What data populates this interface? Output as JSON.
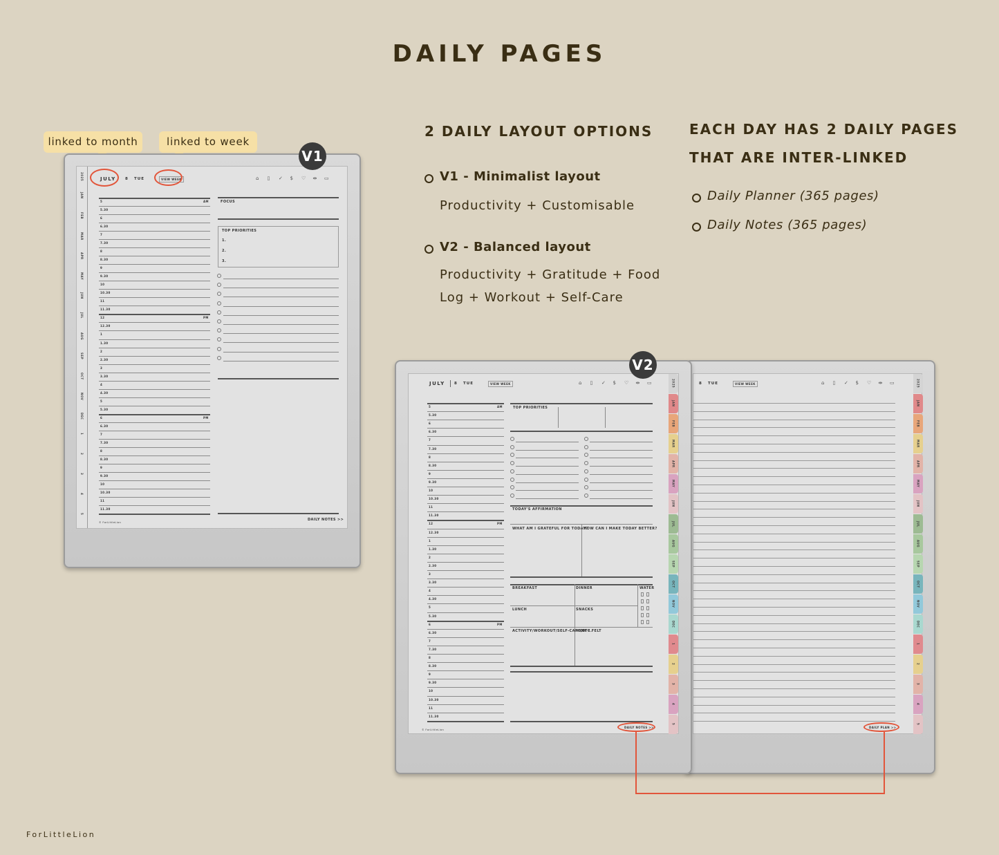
{
  "title": "DAILY PAGES",
  "callouts": {
    "month": "linked to month",
    "week": "linked to week"
  },
  "badges": {
    "v1": "V1",
    "v2": "V2"
  },
  "options": {
    "heading": "2 DAILY LAYOUT OPTIONS",
    "v1_title": "V1 - Minimalist layout",
    "v1_desc": "Productivity + Customisable",
    "v2_title": "V2 - Balanced layout",
    "v2_desc_1": "Productivity + Gratitude + Food",
    "v2_desc_2": "Log + Workout + Self-Care"
  },
  "pages": {
    "heading_1": "EACH DAY HAS 2 DAILY PAGES",
    "heading_2": "THAT ARE INTER-LINKED",
    "items": [
      "Daily Planner (365 pages)",
      "Daily Notes (365 pages)"
    ]
  },
  "planner": {
    "month": "JULY",
    "day": "8",
    "weekday": "TUE",
    "view_week": "VIEW WEEK",
    "year": "2025",
    "icons": [
      "home-icon",
      "document-icon",
      "check-circle-icon",
      "dollar-icon",
      "heart-icon",
      "dumbbell-icon",
      "calendar-icon"
    ],
    "icon_glyphs": [
      "⌂",
      "▯",
      "✓",
      "$",
      "♡",
      "⇹",
      "▭"
    ],
    "times": [
      "5",
      "5.30",
      "6",
      "6.30",
      "7",
      "7.30",
      "8",
      "8.30",
      "9",
      "9.30",
      "10",
      "10.30",
      "11",
      "11.30",
      "12",
      "12.30",
      "1",
      "1.30",
      "2",
      "2.30",
      "3",
      "3.30",
      "4",
      "4.30",
      "5",
      "5.30",
      "6",
      "6.30",
      "7",
      "7.30",
      "8",
      "8.30",
      "9",
      "9.30",
      "10",
      "10.30",
      "11",
      "11.30"
    ],
    "am": "AM",
    "pm": "PM",
    "focus": "FOCUS",
    "top_priorities": "TOP PRIORITIES",
    "priority_numbers": [
      "1.",
      "2.",
      "3."
    ],
    "affirmation": "TODAY'S AFFIRMATION",
    "grateful": "WHAT AM I GRATEFUL FOR TODAY?",
    "better": "HOW CAN I MAKE TODAY BETTER?",
    "breakfast": "BREAKFAST",
    "dinner": "DINNER",
    "water": "WATER",
    "lunch": "LUNCH",
    "snacks": "SNACKS",
    "activity": "ACTIVITY/WORKOUT/SELF-CARE/ETC.",
    "how_felt": "HOW I FELT",
    "daily_notes": "DAILY NOTES >>",
    "daily_plan": "DAILY PLAN >>",
    "copyright": "© ForLittleLion"
  },
  "tabs": [
    {
      "label": "2025",
      "color": "#d4d4d4"
    },
    {
      "label": "JAN",
      "color": "#e0898a"
    },
    {
      "label": "FEB",
      "color": "#e8a67a"
    },
    {
      "label": "MAR",
      "color": "#e6d08e"
    },
    {
      "label": "APR",
      "color": "#e2b3a8"
    },
    {
      "label": "MAY",
      "color": "#d9a3c0"
    },
    {
      "label": "JUN",
      "color": "#e3c3c5"
    },
    {
      "label": "JUL",
      "color": "#9dbb93"
    },
    {
      "label": "AUG",
      "color": "#a8c89e"
    },
    {
      "label": "SEP",
      "color": "#b7d6b0"
    },
    {
      "label": "OCT",
      "color": "#78b5bc"
    },
    {
      "label": "NOV",
      "color": "#92c9da"
    },
    {
      "label": "DEC",
      "color": "#a9d8cf"
    },
    {
      "label": "1",
      "color": "#e08a8e"
    },
    {
      "label": "2",
      "color": "#e6d08e"
    },
    {
      "label": "3",
      "color": "#e2b3a8"
    },
    {
      "label": "4",
      "color": "#d9a3c0"
    },
    {
      "label": "5",
      "color": "#e3c3c5"
    }
  ],
  "accent": "#e2553a",
  "footer": "ForLittleLion"
}
